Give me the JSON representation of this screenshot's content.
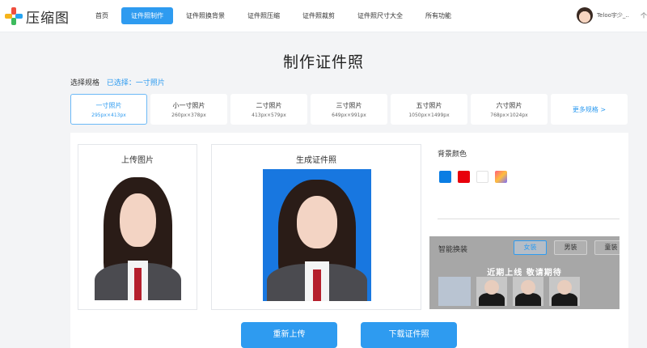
{
  "logo": {
    "text": "压缩图"
  },
  "nav": [
    {
      "label": "首页",
      "active": false
    },
    {
      "label": "证件照制作",
      "active": true
    },
    {
      "label": "证件照换背景",
      "active": false
    },
    {
      "label": "证件照压缩",
      "active": false
    },
    {
      "label": "证件照裁剪",
      "active": false
    },
    {
      "label": "证件照尺寸大全",
      "active": false
    },
    {
      "label": "所有功能",
      "active": false
    }
  ],
  "user": {
    "name": "Teloo宇少_..",
    "more": "个"
  },
  "page": {
    "title": "制作证件照"
  },
  "spec": {
    "label": "选择规格",
    "selected": "已选择：一寸照片"
  },
  "sizes": [
    {
      "name": "一寸照片",
      "dims": "295px×413px",
      "active": true
    },
    {
      "name": "小一寸照片",
      "dims": "260px×378px"
    },
    {
      "name": "二寸照片",
      "dims": "413px×579px"
    },
    {
      "name": "三寸照片",
      "dims": "649px×991px"
    },
    {
      "name": "五寸照片",
      "dims": "1050px×1499px"
    },
    {
      "name": "六寸照片",
      "dims": "768px×1024px"
    }
  ],
  "more_sizes": "更多规格 >",
  "upload": {
    "title": "上传图片"
  },
  "result": {
    "title": "生成证件照"
  },
  "background": {
    "label": "背景颜色",
    "colors": [
      "#0a7de3",
      "#e8000b",
      "#ffffff",
      "gradient"
    ]
  },
  "outfit": {
    "title": "智能换装",
    "tabs": [
      "女装",
      "男装",
      "童装"
    ],
    "active_tab": "女装",
    "overlay": "近期上线 敬请期待"
  },
  "buttons": {
    "reupload": "重新上传",
    "download": "下载证件照"
  }
}
